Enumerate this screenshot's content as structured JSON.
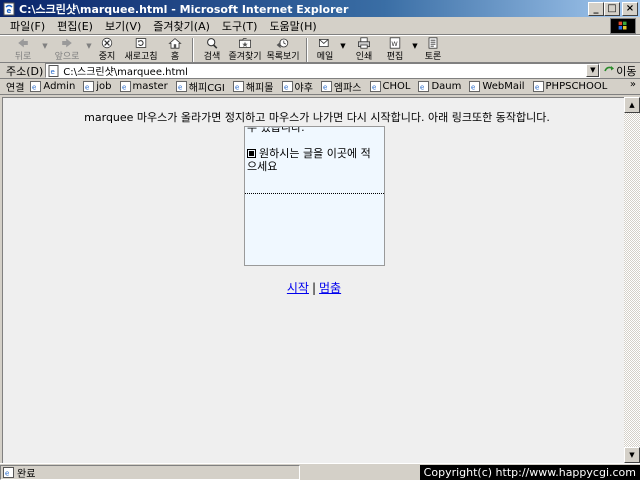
{
  "window": {
    "title": "C:\\스크린샷\\marquee.html - Microsoft Internet Explorer",
    "minimize": "_",
    "maximize": "□",
    "close": "×"
  },
  "menu": {
    "items": [
      "파일(F)",
      "편집(E)",
      "보기(V)",
      "즐겨찾기(A)",
      "도구(T)",
      "도움말(H)"
    ]
  },
  "toolbar": {
    "back": "뒤로",
    "forward": "앞으로",
    "stop": "중지",
    "refresh": "새로고침",
    "home": "홈",
    "search": "검색",
    "favorites": "즐겨찾기",
    "history": "목록보기",
    "mail": "메일",
    "print": "인쇄",
    "edit": "편집",
    "discuss": "토론"
  },
  "address": {
    "label": "주소(D)",
    "value": "C:\\스크린샷\\marquee.html",
    "go_label": "이동"
  },
  "links": {
    "label": "연결",
    "items": [
      "Admin",
      "job",
      "master",
      "해피CGI",
      "해피몰",
      "야후",
      "엠파스",
      "CHOL",
      "Daum",
      "WebMail",
      "PHPSCHOOL"
    ],
    "more": "»"
  },
  "content": {
    "intro": "marquee 마우스가 올라가면 정지하고 마우스가 나가면 다시 시작합니다. 아래 링크또한 동작합니다.",
    "marquee_partial": "수 있습니다.",
    "marquee_item_line1": "원하시는 글을 이곳에 적",
    "marquee_item_line2": "으세요",
    "start_link": "시작",
    "separator": "|",
    "stop_link": "멈춤"
  },
  "status": {
    "text": "완료"
  },
  "copyright": "Copyright(c) http://www.happycgi.com"
}
